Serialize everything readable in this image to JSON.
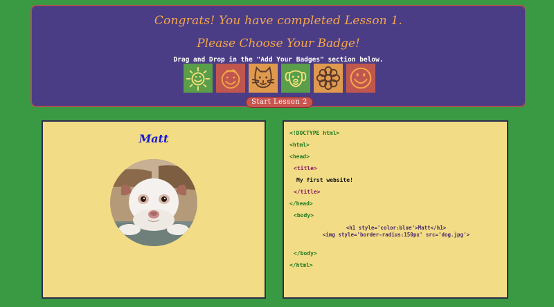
{
  "banner": {
    "heading": "Congrats! You have completed Lesson 1.",
    "subheading": "Please Choose Your Badge!",
    "instructions": "Drag and Drop in the \"Add Your Badges\" section below.",
    "badges": [
      {
        "icon": "sun-icon",
        "color": "#5a9e4a"
      },
      {
        "icon": "smiley-face-icon",
        "color": "#c0574f"
      },
      {
        "icon": "cat-icon",
        "color": "#e09a4e"
      },
      {
        "icon": "dog-icon",
        "color": "#5a9e4a"
      },
      {
        "icon": "flower-icon",
        "color": "#e09a4e"
      },
      {
        "icon": "smiley-icon",
        "color": "#c0574f"
      }
    ],
    "start_button": "Start Lesson 2"
  },
  "preview": {
    "name": "Matt",
    "name_color": "#1a1ad0",
    "photo": "dog-photo"
  },
  "code": {
    "lines": [
      "<!DOCTYPE html>",
      "<html>",
      "<head>",
      "<title>",
      "My first website!",
      "</title>",
      "</head>",
      "<body>",
      "<h1 style='color:blue'>Matt</h1>",
      "<img style='border-radius:150px' src='dog.jpg'>",
      "</body>",
      "</html>"
    ]
  },
  "colors": {
    "background": "#3a9a43",
    "banner": "#4b3d85",
    "banner_text": "#f3a64b",
    "panel": "#f2dc86",
    "button": "#c85550"
  }
}
